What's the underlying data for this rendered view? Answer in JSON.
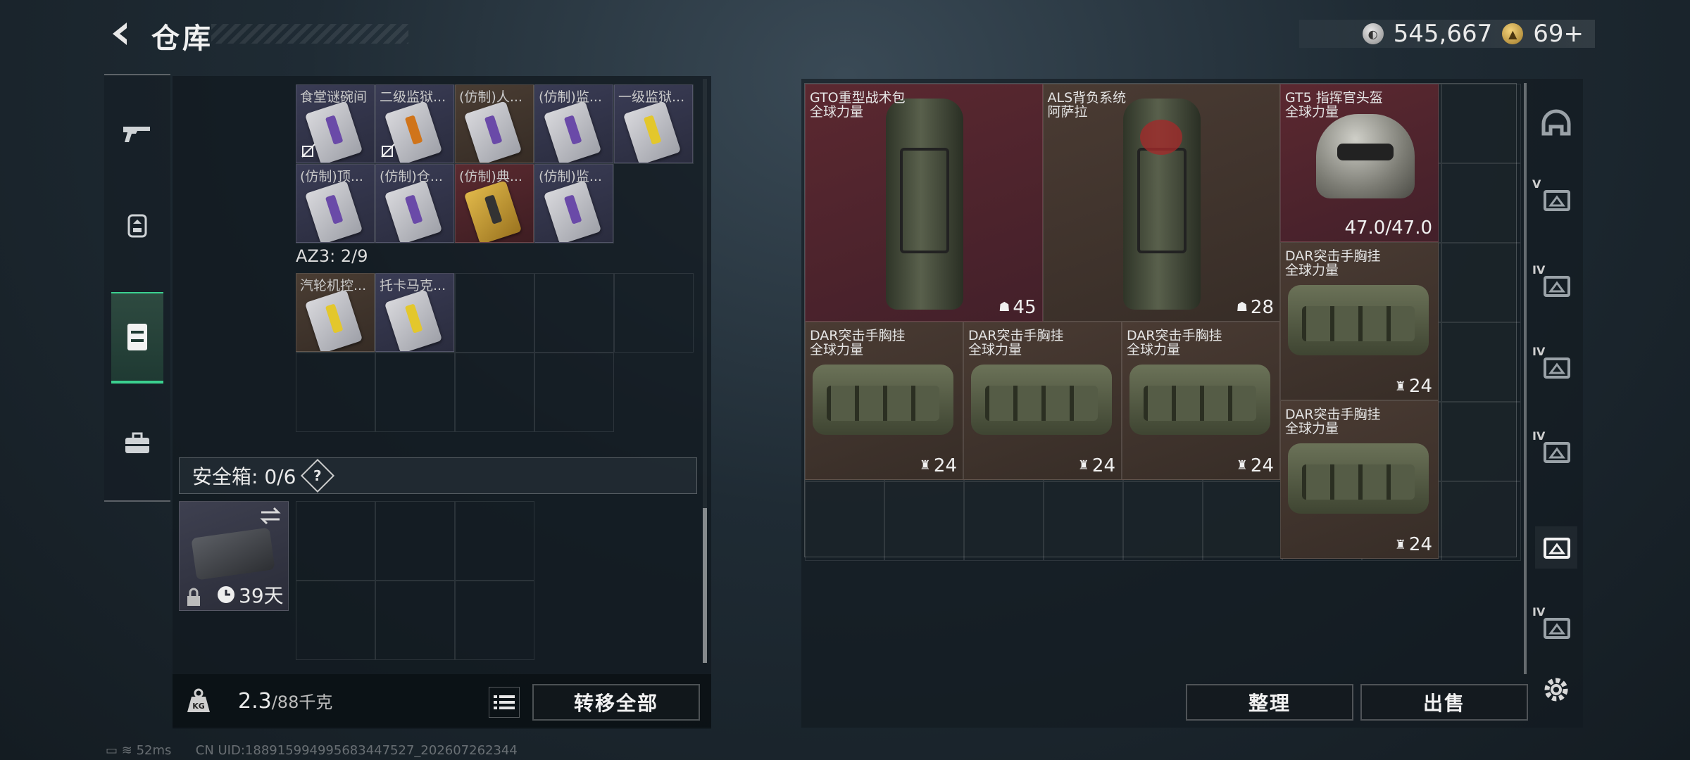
{
  "header": {
    "title": "仓库",
    "currency": [
      {
        "icon": "silver-coin-icon",
        "value": "545,667"
      },
      {
        "icon": "gold-coin-icon",
        "value": "69+"
      }
    ]
  },
  "left_tabs": [
    {
      "icon": "gun-icon"
    },
    {
      "icon": "backpack-icon"
    },
    {
      "icon": "chest-rig-icon",
      "active": true
    },
    {
      "icon": "briefcase-icon"
    }
  ],
  "container_1": {
    "items": [
      {
        "label": "食堂谜碗间",
        "bg": "purple",
        "card": "purple",
        "nochange": true
      },
      {
        "label": "二级监狱...",
        "bg": "purple",
        "card": "orange",
        "nochange": true
      },
      {
        "label": "(仿制)人...",
        "bg": "brown",
        "card": "purple"
      },
      {
        "label": "(仿制)监...",
        "bg": "purple",
        "card": "purple"
      },
      {
        "label": "一级监狱...",
        "bg": "purple",
        "card": "yellow"
      },
      {
        "label": "(仿制)顶...",
        "bg": "purple",
        "card": "purple"
      },
      {
        "label": "(仿制)仓...",
        "bg": "purple",
        "card": "purple"
      },
      {
        "label": "(仿制)典...",
        "bg": "red",
        "card": "gold"
      },
      {
        "label": "(仿制)监...",
        "bg": "purple",
        "card": "purple"
      }
    ]
  },
  "container_2": {
    "label": "AZ3: 2/9",
    "items": [
      {
        "label": "汽轮机控...",
        "bg": "brown",
        "card": "yellow"
      },
      {
        "label": "托卡马克...",
        "bg": "purple",
        "card": "yellow"
      }
    ]
  },
  "safebox": {
    "title": "安全箱: 0/6",
    "help": "?",
    "days": "39天"
  },
  "weight": {
    "current": "2.3",
    "max": "/88千克"
  },
  "buttons": {
    "transfer_all": "转移全部",
    "organize": "整理",
    "sell": "出售"
  },
  "stash": {
    "items": [
      {
        "name": "GTO重型战术包",
        "sub": "全球力量",
        "stat": "45",
        "kind": "backpack",
        "bg": "red"
      },
      {
        "name": "ALS背负系统",
        "sub": "阿萨拉",
        "stat": "28",
        "kind": "backpack-mark",
        "bg": "brown"
      },
      {
        "name": "GT5 指挥官头盔",
        "sub": "全球力量",
        "stat": "47.0/47.0",
        "kind": "helmet",
        "bg": "red"
      },
      {
        "name": "DAR突击手胸挂",
        "sub": "全球力量",
        "stat": "24",
        "kind": "vest",
        "bg": "brown"
      },
      {
        "name": "DAR突击手胸挂",
        "sub": "全球力量",
        "stat": "24",
        "kind": "vest",
        "bg": "brown"
      },
      {
        "name": "DAR突击手胸挂",
        "sub": "全球力量",
        "stat": "24",
        "kind": "vest",
        "bg": "brown"
      },
      {
        "name": "DAR突击手胸挂",
        "sub": "全球力量",
        "stat": "24",
        "kind": "vest",
        "bg": "brown"
      },
      {
        "name": "DAR突击手胸挂",
        "sub": "全球力量",
        "stat": "24",
        "kind": "vest",
        "bg": "brown"
      }
    ]
  },
  "right_nav": [
    {
      "icon": "helmet-filter-icon",
      "label": ""
    },
    {
      "icon": "tier5-filter-icon",
      "label": "V"
    },
    {
      "icon": "tier4-folder-icon",
      "label": "IV"
    },
    {
      "icon": "tier4-gun-icon",
      "label": "IV"
    },
    {
      "icon": "tier4-badge-icon",
      "label": "IV"
    },
    {
      "icon": "all-filter-icon",
      "label": "",
      "active": true
    },
    {
      "icon": "tier4-add-icon",
      "label": "IV"
    }
  ],
  "status": {
    "ping": "52ms",
    "uid": "CN UID:1889159949956834475​27_202607262344"
  }
}
